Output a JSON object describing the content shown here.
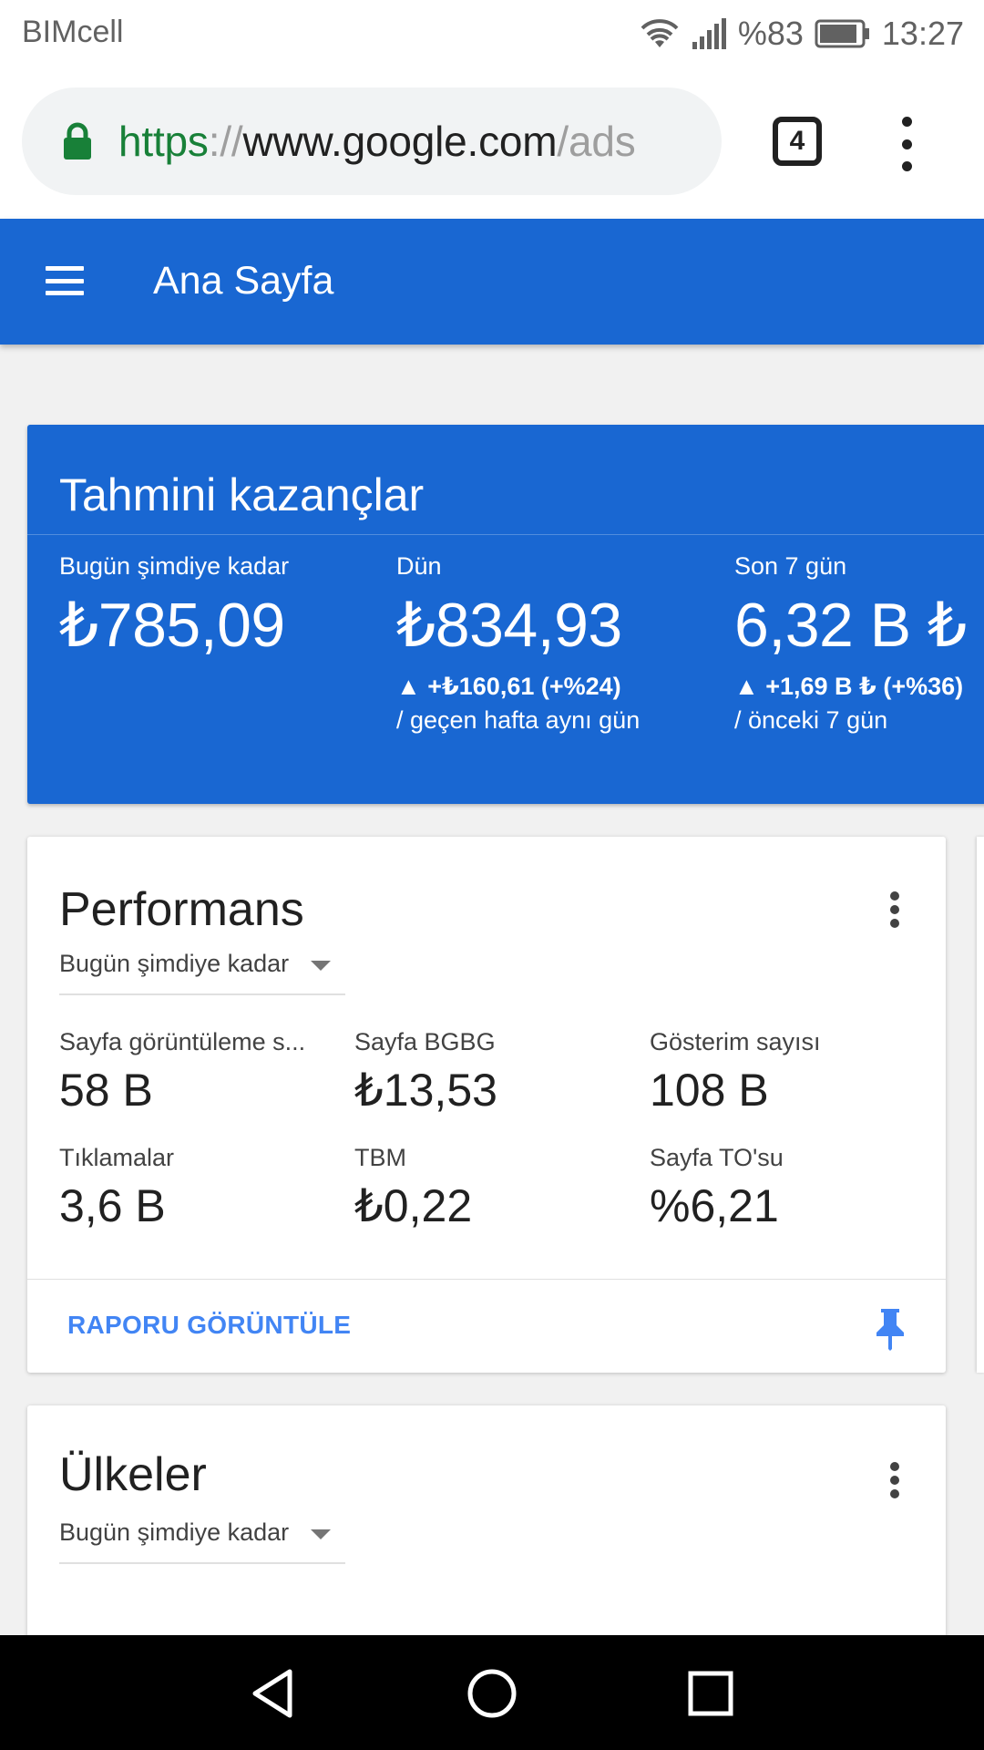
{
  "status_bar": {
    "carrier": "BIMcell",
    "battery": "%83",
    "time": "13:27"
  },
  "browser": {
    "url": {
      "scheme": "https",
      "separator": "://",
      "host": "www.google.com",
      "path": "/ads"
    },
    "tab_count": "4"
  },
  "app_bar": {
    "title": "Ana Sayfa"
  },
  "earnings": {
    "title": "Tahmini kazançlar",
    "columns": [
      {
        "label": "Bugün şimdiye kadar",
        "value": "₺785,09",
        "delta": "",
        "compare": ""
      },
      {
        "label": "Dün",
        "value": "₺834,93",
        "delta": "▲ +₺160,61 (+%24)",
        "compare": "/ geçen hafta aynı gün"
      },
      {
        "label": "Son 7 gün",
        "value": "6,32 B ₺",
        "delta": "▲ +1,69 B ₺ (+%36)",
        "compare": "/ önceki 7 gün"
      }
    ]
  },
  "performance": {
    "title": "Performans",
    "range": "Bugün şimdiye kadar",
    "metrics": [
      {
        "label": "Sayfa görüntüleme s...",
        "value": "58 B"
      },
      {
        "label": "Sayfa BGBG",
        "value": "₺13,53"
      },
      {
        "label": "Gösterim sayısı",
        "value": "108 B"
      },
      {
        "label": "Tıklamalar",
        "value": "3,6 B"
      },
      {
        "label": "TBM",
        "value": "₺0,22"
      },
      {
        "label": "Sayfa TO'su",
        "value": "%6,21"
      }
    ],
    "report_link": "RAPORU GÖRÜNTÜLE"
  },
  "countries": {
    "title": "Ülkeler",
    "range": "Bugün şimdiye kadar"
  },
  "colors": {
    "primary": "#1967d2",
    "link": "#4285f4",
    "secure": "#188038"
  },
  "icons": [
    "lock-icon",
    "wifi-icon",
    "signal-icon",
    "battery-icon",
    "menu-icon",
    "more-vert-icon",
    "dropdown-caret-icon",
    "pin-icon",
    "back-icon",
    "home-icon",
    "recents-icon"
  ]
}
